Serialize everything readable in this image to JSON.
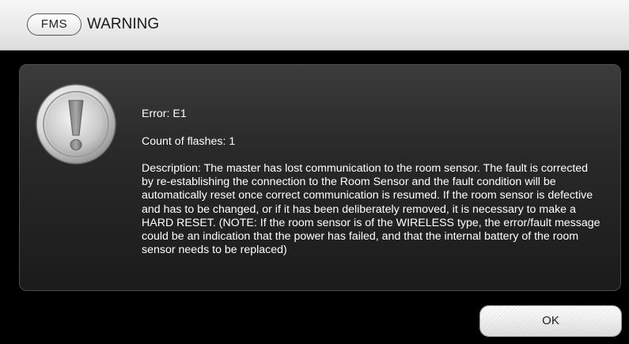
{
  "window": {
    "badge": "FMS",
    "title": "WARNING"
  },
  "message": {
    "error_line": "Error: E1",
    "flashes_line": "Count of flashes: 1",
    "description": "Description: The master has lost communication to the room sensor. The fault is corrected by re-establishing the connection to the Room Sensor and the fault condition will be automatically reset once correct communication is resumed. If the room sensor is defective and has to be changed, or if it has been deliberately removed, it is necessary to make a HARD RESET. (NOTE: If the room sensor is of the WIRELESS type, the error/fault message could be an indication that the power has failed, and that the internal battery of the room sensor needs to be replaced)"
  },
  "icon": {
    "name": "exclamation-icon"
  },
  "buttons": {
    "ok_label": "OK"
  }
}
